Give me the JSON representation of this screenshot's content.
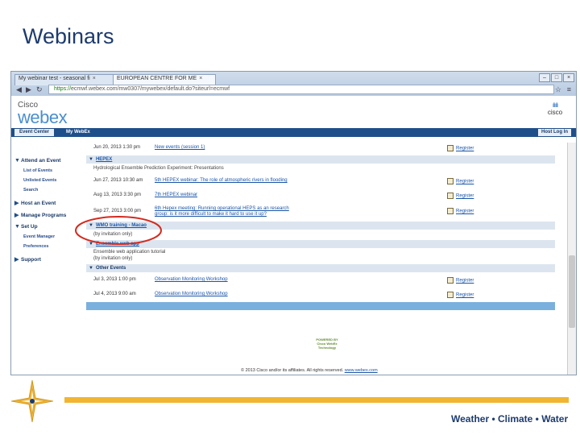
{
  "slide": {
    "title": "Webinars",
    "tagline": "Weather • Climate • Water"
  },
  "browser": {
    "tabs": [
      {
        "label": "My webinar test - seasonal fi",
        "active": false
      },
      {
        "label": "EUROPEAN CENTRE FOR ME",
        "active": true
      }
    ],
    "url_secure": "https://",
    "url_rest": "ecmwf.webex.com/mw0307/mywebex/default.do?siteurl=ecmwf"
  },
  "webex": {
    "cisco_small": "Cisco",
    "logo": "webex",
    "cisco_mark": "cisco",
    "nav": {
      "event_center": "Event Center",
      "my_webex": "My WebEx",
      "host_login": "Host Log In"
    }
  },
  "sidebar": {
    "items": [
      {
        "label": "Attend an Event",
        "expanded": true
      },
      {
        "label": "Host an Event",
        "expanded": false
      },
      {
        "label": "Manage Programs",
        "expanded": false
      },
      {
        "label": "Set Up",
        "expanded": true
      },
      {
        "label": "Support",
        "expanded": false
      }
    ],
    "attend_subitems": [
      "List of Events",
      "Unlisted Events",
      "Search"
    ],
    "setup_subitems": [
      "Event Manager",
      "Preferences"
    ]
  },
  "events": {
    "first_row": {
      "date": "Jun 20, 2013 1:30 pm",
      "name": "New events (session 1)",
      "register": "Register"
    },
    "groups": [
      {
        "label": "HEPEX",
        "description": "Hydrological Ensemble Prediction Experiment: Presentations",
        "rows": [
          {
            "date": "Jun 27, 2013 10:30 am",
            "name": "5th HEPEX webinar: The role of atmospheric rivers in flooding",
            "register": "Register"
          },
          {
            "date": "Aug 13, 2013 3:30 pm",
            "name": "7th HEPEX webinar",
            "register": "Register"
          },
          {
            "date": "Sep 27, 2013 3:00 pm",
            "name": "6th Hepex meeting: Running operational HEPS as an research",
            "name2": "group: is it more difficult to make it hard to use it up?",
            "register": "Register"
          }
        ]
      },
      {
        "label": "WMO training - Macao",
        "description": "(by invitation only)"
      },
      {
        "label": "Ensemble web app",
        "description": "Ensemble web application tutorial",
        "description2": "(by invitation only)"
      },
      {
        "label": "Other Events",
        "rows": [
          {
            "date": "Jul 3, 2013 1:00 pm",
            "name": "Observation Monitoring Workshop",
            "register": "Register"
          },
          {
            "date": "Jul 4, 2013 9:00 am",
            "name": "Observation Monitoring Workshop",
            "register": "Register"
          }
        ]
      }
    ]
  },
  "footer": {
    "powered_by": [
      "POWERED BY",
      "Cisco WebEx",
      "Technology"
    ],
    "copyright": "© 2013 Cisco and/or its affiliates. All rights reserved.",
    "copyright_link": "www.webex.com"
  },
  "colors": {
    "accent_orange": "#f1b531",
    "title_blue": "#1d3b6e",
    "highlight_red": "#d42a1e",
    "webex_blue": "#4a8fd0"
  }
}
